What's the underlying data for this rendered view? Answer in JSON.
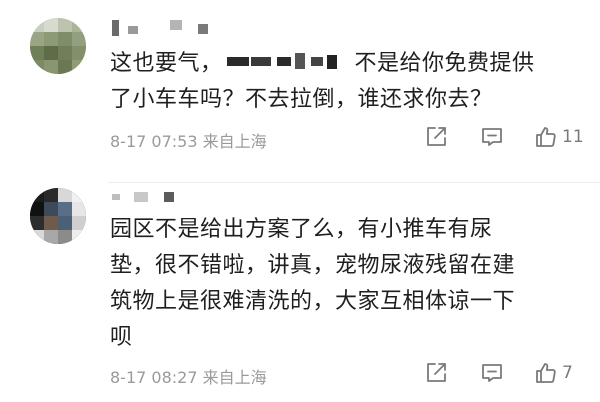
{
  "comments": [
    {
      "author": "",
      "text_lines": [
        "这也要气，",
        "不是给你免费提供",
        "了小车车吗？不去拉倒，谁还求你去？"
      ],
      "date": "8-17",
      "time": "07:53",
      "location": "来自上海",
      "likes": "11",
      "icons": {
        "share": "share-icon",
        "reply": "comment-icon",
        "like": "thumbs-up-icon"
      }
    },
    {
      "author": "",
      "text_lines": [
        "园区不是给出方案了么，有小推车有尿",
        "垫，很不错啦，讲真，宠物尿液残留在建",
        "筑物上是很难清洗的，大家互相体谅一下",
        "呗"
      ],
      "date": "8-17",
      "time": "08:27",
      "location": "来自上海",
      "likes": "7",
      "icons": {
        "share": "share-icon",
        "reply": "comment-icon",
        "like": "thumbs-up-icon"
      }
    }
  ],
  "colors": {
    "text": "#1f1f1f",
    "meta": "#9a9a9a",
    "icon": "#7a7a7a",
    "divider": "#ececec"
  }
}
